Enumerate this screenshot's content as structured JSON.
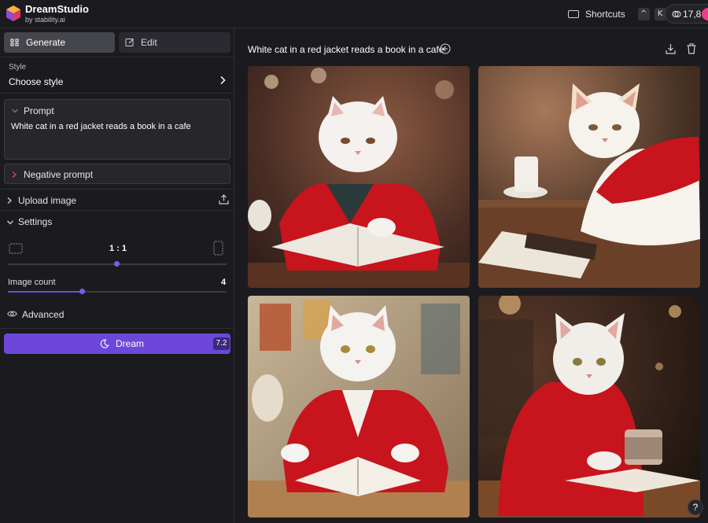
{
  "app": {
    "title": "DreamStudio",
    "subtitle": "by stability.ai"
  },
  "header": {
    "shortcuts_label": "Shortcuts",
    "shortcut_keys": [
      "^",
      "K"
    ],
    "credits": "17,8"
  },
  "sidebar": {
    "tabs": [
      {
        "label": "Generate",
        "icon": "grid-icon",
        "active": true
      },
      {
        "label": "Edit",
        "icon": "edit-icon",
        "active": false
      }
    ],
    "style": {
      "label": "Style",
      "value": "Choose style"
    },
    "prompt": {
      "title": "Prompt",
      "text": "White cat in a red jacket reads a book in a cafe"
    },
    "negative_prompt": {
      "title": "Negative prompt"
    },
    "upload_image": {
      "label": "Upload image"
    },
    "settings": {
      "label": "Settings",
      "aspect_ratio": "1 : 1",
      "aspect_slider_level": 0.5,
      "image_count_label": "Image count",
      "image_count": "4",
      "image_count_level": 0.33
    },
    "advanced": {
      "label": "Advanced"
    },
    "dream_button": {
      "label": "Dream",
      "cost": "7.2"
    }
  },
  "main": {
    "title": "White cat in a red jacket reads a book in a cafe",
    "images": [
      {
        "name": "generated-image-1"
      },
      {
        "name": "generated-image-2"
      },
      {
        "name": "generated-image-3"
      },
      {
        "name": "generated-image-4"
      }
    ],
    "help_label": "?"
  },
  "colors": {
    "accent": "#6d47d9",
    "background": "#1b1b1f",
    "panel": "#26262b",
    "jacket_red": "#c8141c"
  }
}
